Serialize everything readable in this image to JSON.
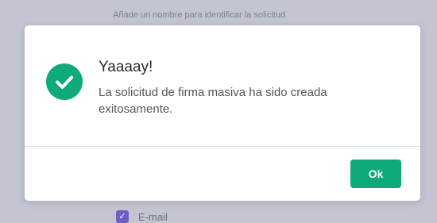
{
  "background": {
    "hint_text": "Añade un nombre para identificar la solicitud",
    "checkbox_label": "E-mail",
    "checkbox_checked": true
  },
  "dialog": {
    "title": "Yaaaay!",
    "message": "La solicitud de firma masiva ha sido creada exitosamente.",
    "icon": "check-circle-icon",
    "ok_label": "Ok"
  },
  "colors": {
    "accent": "#0eaa7c",
    "overlay": "#c3c5d2",
    "checkbox": "#6c5fc7"
  }
}
